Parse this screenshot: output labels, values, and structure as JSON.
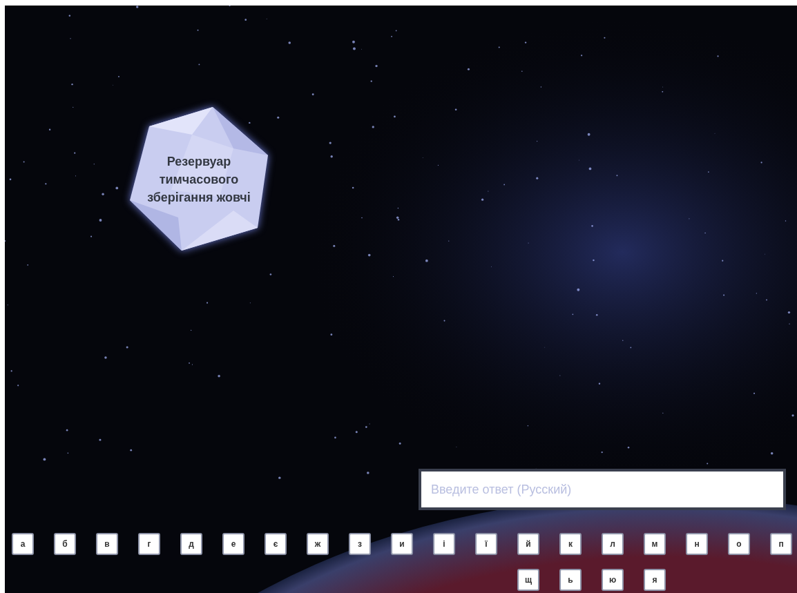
{
  "crystal": {
    "label": "Резервуар тимчасового зберігання жовчі"
  },
  "answer_field": {
    "placeholder": "Введите ответ (Русский)"
  },
  "keyboard": {
    "rows": [
      [
        "а",
        "б",
        "в",
        "г",
        "д",
        "е",
        "є",
        "ж",
        "з",
        "и",
        "і",
        "ї",
        "й",
        "к",
        "л",
        "м",
        "н",
        "о",
        "п"
      ],
      [
        "",
        "",
        "",
        "",
        "",
        "",
        "",
        "",
        "",
        "",
        "",
        "",
        "щ",
        "ь",
        "ю",
        "я"
      ]
    ]
  }
}
